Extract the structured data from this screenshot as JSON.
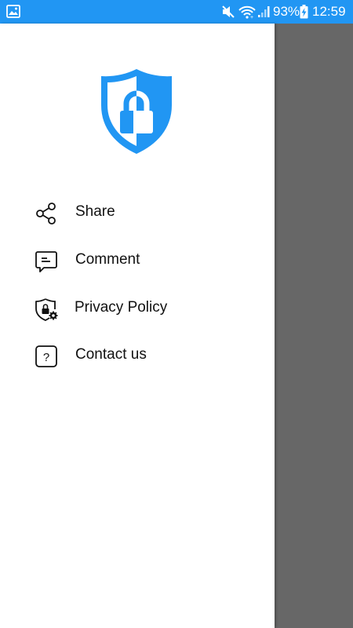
{
  "status_bar": {
    "battery_percent": "93%",
    "time": "12:59",
    "icons": [
      "gallery-icon",
      "mute-icon",
      "wifi-icon",
      "signal-icon",
      "battery-charging-icon"
    ]
  },
  "drawer": {
    "logo_icon": "shield-lock-icon",
    "menu": [
      {
        "label": "Share",
        "icon": "share-icon"
      },
      {
        "label": "Comment",
        "icon": "comment-icon"
      },
      {
        "label": "Privacy Policy",
        "icon": "privacy-shield-icon"
      },
      {
        "label": "Contact us",
        "icon": "help-question-icon"
      }
    ]
  },
  "colors": {
    "accent": "#2196F3",
    "scrim": "#676767",
    "drawer_background": "#FFFFFF"
  }
}
